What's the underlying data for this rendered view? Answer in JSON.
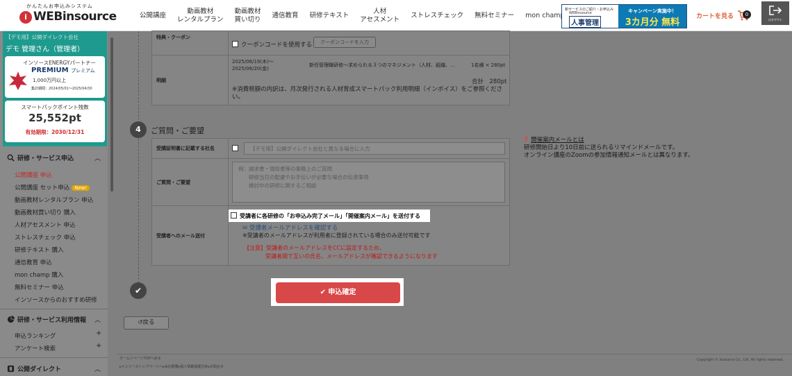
{
  "header": {
    "logo_tagline": "かんたんお申込みシステム",
    "logo_mark": "i",
    "logo_text": "WEBinsource",
    "nav": [
      "公開講座",
      "動画教材\nレンタルプラン",
      "動画教材\n買い切り",
      "通信教育",
      "研修テキスト",
      "人材\nアセスメント",
      "ストレスチェック",
      "無料セミナー",
      "mon champ"
    ],
    "promo": {
      "line1": "新サービスのご紹介・お申込み",
      "line2": "WEBinsource",
      "line3": "人事管理",
      "right1": "キャンペーン実施中！",
      "right2": "3カ月分 無料"
    },
    "cart_label": "カートを見る",
    "cart_count": "0",
    "logout_label": "ログアウト"
  },
  "sidebar": {
    "company": "【デモ用】公開ダイレクト会社",
    "user_name": "デモ 管理さん（管理者）",
    "partner_label": "インソースENERGYパートナー",
    "premium": "PREMIUM",
    "premium_sub": "プレミアム",
    "premium_amount": "1,000万円以上",
    "premium_period": "集計期間：2024/05/01〜2025/04/30",
    "points_label": "スマートパックポイント残数",
    "points_value": "25,552pt",
    "points_expiry": "有効期限：2030/12/31",
    "sections": [
      {
        "title": "研修・サービス申込",
        "items": [
          "公開講座 申込",
          "公開講座 セット申込",
          "動画教材レンタルプラン 申込",
          "動画教材買い切り 購入",
          "人材アセスメント 申込",
          "ストレスチェック 申込",
          "研修テキスト 購入",
          "通信教育 申込",
          "mon champ 購入",
          "無料セミナー 申込",
          "インソースからのおすすめ研修"
        ],
        "new_badge": "New!"
      },
      {
        "title": "研修・サービス利用情報",
        "items": [
          "申込ランキング",
          "アンケート検索"
        ]
      },
      {
        "title": "公開ダイレクト"
      }
    ]
  },
  "order": {
    "coupon_header": "特典・クーポン",
    "coupon_check": "クーポンコードを使用する",
    "coupon_button": "クーポンコードを入力",
    "detail_header": "明細",
    "detail_dates": "2025/06/19(木)〜\n2025/06/20(金)",
    "detail_course": "新任管理職研修～求められる３つのマネジメント（人材、組織、…",
    "detail_qty": "1名様 × 280pt",
    "detail_total": "合計　280pt",
    "detail_note": "※消費税額の内訳は、月次発行される人材育成スマートパック利用明細（インボイス）をご参照ください。"
  },
  "questions": {
    "step": "4",
    "title": "ご質問・ご要望",
    "cert_header": "受講証明書に記載する社名",
    "cert_placeholder": "【デモ用】公開ダイレクト会社と異なる場合に入力",
    "q_header": "ご質問・ご要望",
    "q_placeholder": "例：請求書・領収書等の事務上のご質問\n　　研修当日の配慮やお手伝いが必要な場合の伝達事項\n　　検討中の研修に関するご相談",
    "mail_header": "受講者へのメール送付",
    "mail_check": "受講者に各研修の「お申込み完了メール」「開催案内メール」を送付する",
    "mail_link": "受講者メールアドレスを確認する",
    "mail_note": "※受講者のメールアドレスが利用者に登録されている場合のみ送付可能です",
    "warn1": "【注意】受講者のメールアドレスをCCに設定するため、",
    "warn2": "受講者間で互いの氏名、メールアドレスが確認できるようになります",
    "info_title": "開催案内メールとは",
    "info_line1": "研修開始日より10日前に送られるリマインドメールです。",
    "info_line2": "オンライン講座のZoomの参加情報通知メールとは異なります。"
  },
  "actions": {
    "confirm": "✔ 申込確定",
    "back": "↺戻る"
  },
  "footer": {
    "a": "ホーム＞ページTOPへ戻る",
    "b": "▸インソーストップページへ▸会社概要▸個人情報保護方針▸お問合せ",
    "c": "Copyright © Insource Co., Ltd. All rights reserved."
  }
}
